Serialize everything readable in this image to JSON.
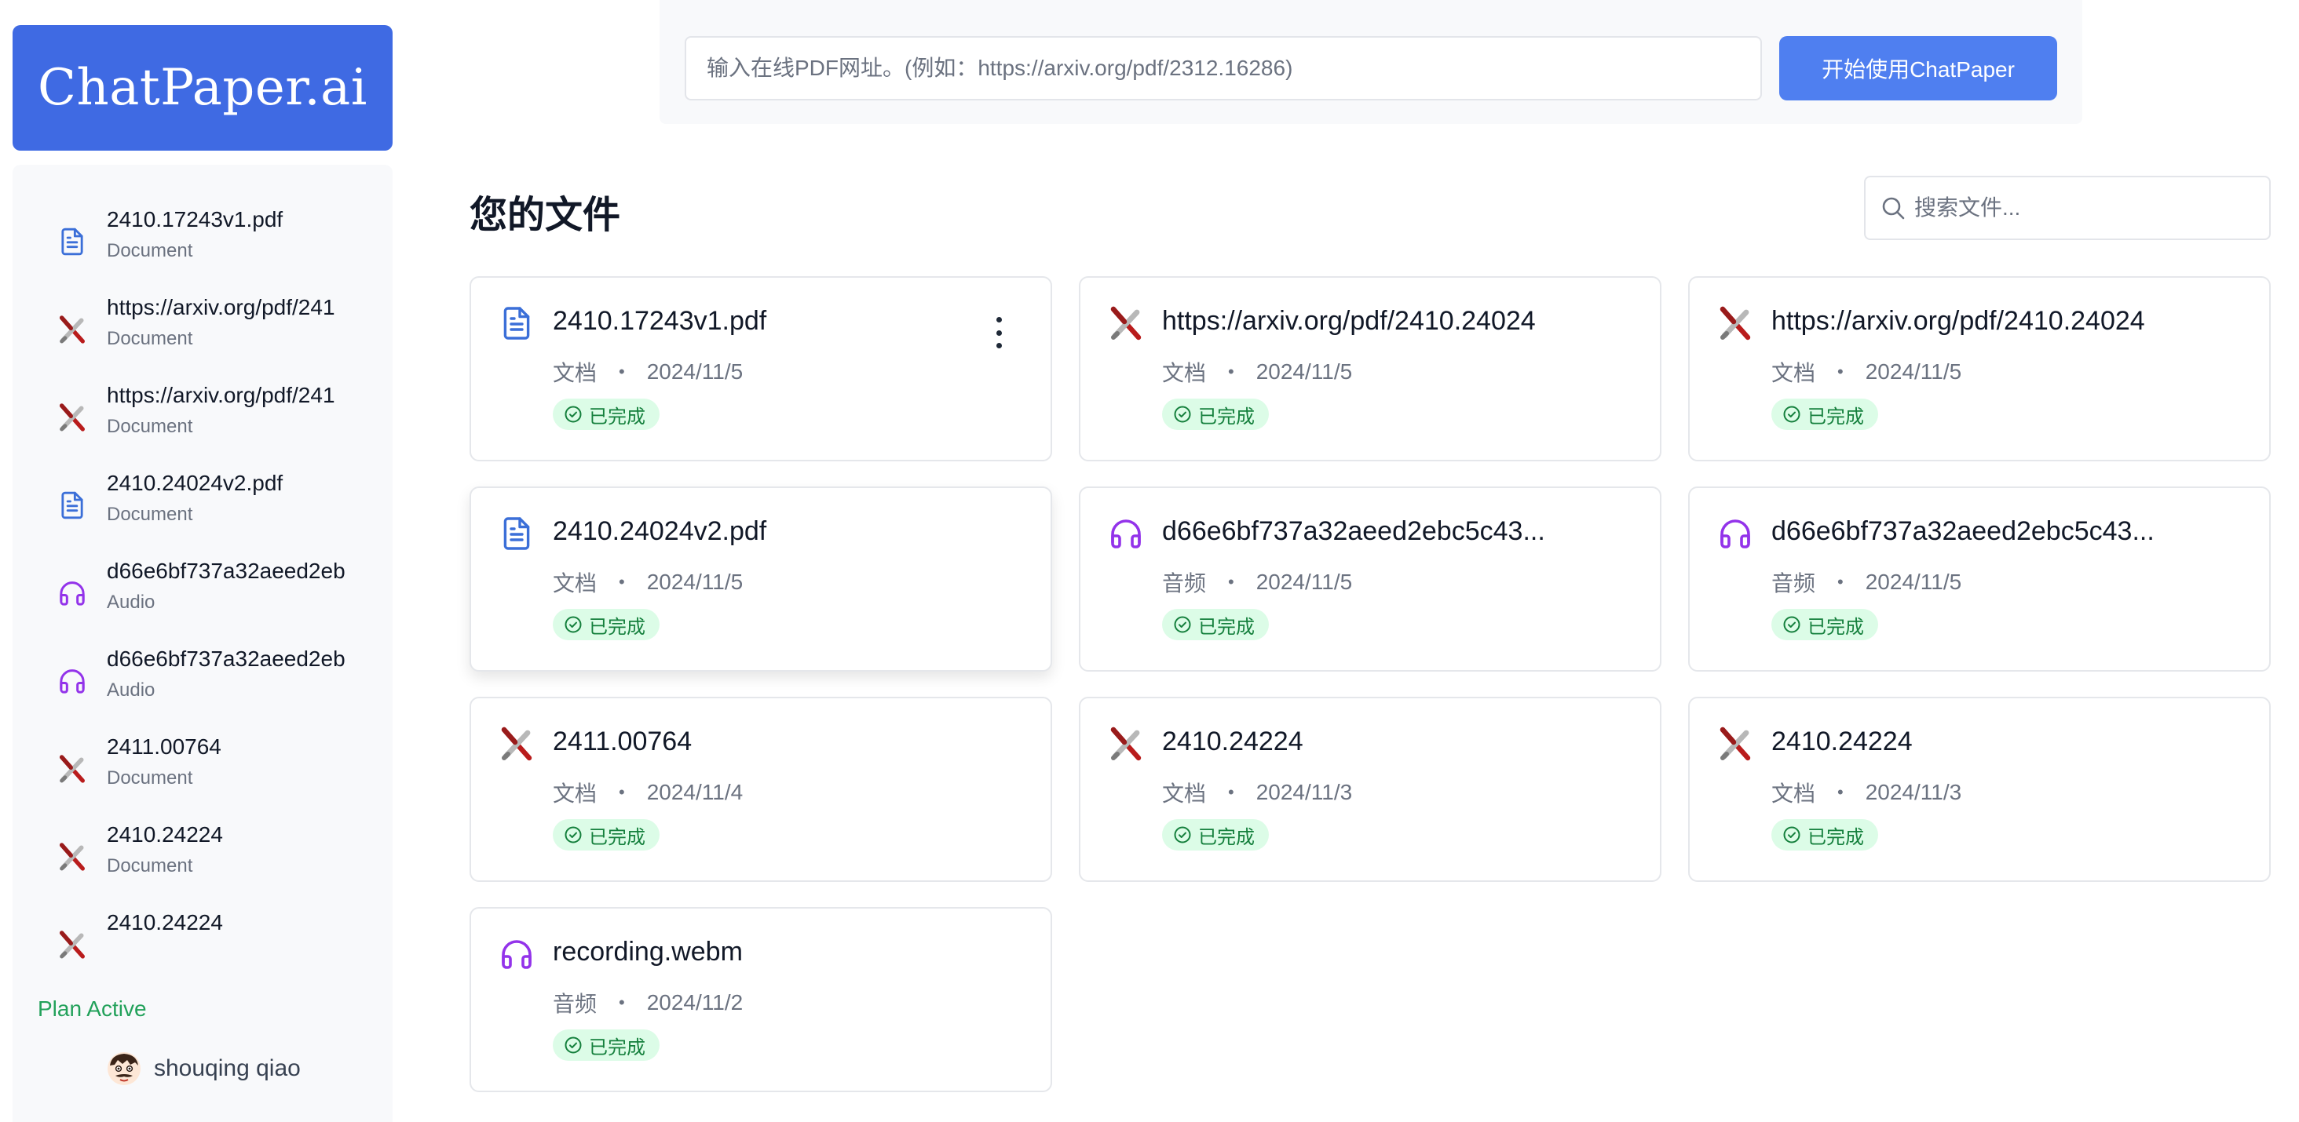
{
  "app": {
    "logo_text": "ChatPaper.ai"
  },
  "topbar": {
    "url_placeholder": "输入在线PDF网址。(例如：https://arxiv.org/pdf/2312.16286)",
    "start_button_label": "开始使用ChatPaper"
  },
  "main": {
    "title": "您的文件",
    "search_placeholder": "搜索文件..."
  },
  "sidebar": {
    "items": [
      {
        "title": "2410.17243v1.pdf",
        "subtitle": "Document",
        "icon": "document-icon"
      },
      {
        "title": "https://arxiv.org/pdf/241",
        "subtitle": "Document",
        "icon": "broken-pencil-icon"
      },
      {
        "title": "https://arxiv.org/pdf/241",
        "subtitle": "Document",
        "icon": "broken-pencil-icon"
      },
      {
        "title": "2410.24024v2.pdf",
        "subtitle": "Document",
        "icon": "document-icon"
      },
      {
        "title": "d66e6bf737a32aeed2eb",
        "subtitle": "Audio",
        "icon": "headphones-icon"
      },
      {
        "title": "d66e6bf737a32aeed2eb",
        "subtitle": "Audio",
        "icon": "headphones-icon"
      },
      {
        "title": "2411.00764",
        "subtitle": "Document",
        "icon": "broken-pencil-icon"
      },
      {
        "title": "2410.24224",
        "subtitle": "Document",
        "icon": "broken-pencil-icon"
      },
      {
        "title": "2410.24224",
        "subtitle": "",
        "icon": "broken-pencil-icon"
      }
    ],
    "plan_status": "Plan Active",
    "user_name": "shouqing qiao"
  },
  "files": [
    {
      "title": "2410.17243v1.pdf",
      "type": "文档",
      "date": "2024/11/5",
      "status": "已完成",
      "icon": "document-icon"
    },
    {
      "title": "https://arxiv.org/pdf/2410.24024",
      "type": "文档",
      "date": "2024/11/5",
      "status": "已完成",
      "icon": "broken-pencil-icon"
    },
    {
      "title": "https://arxiv.org/pdf/2410.24024",
      "type": "文档",
      "date": "2024/11/5",
      "status": "已完成",
      "icon": "broken-pencil-icon"
    },
    {
      "title": "2410.24024v2.pdf",
      "type": "文档",
      "date": "2024/11/5",
      "status": "已完成",
      "icon": "document-icon"
    },
    {
      "title": "d66e6bf737a32aeed2ebc5c43...",
      "type": "音频",
      "date": "2024/11/5",
      "status": "已完成",
      "icon": "headphones-icon"
    },
    {
      "title": "d66e6bf737a32aeed2ebc5c43...",
      "type": "音频",
      "date": "2024/11/5",
      "status": "已完成",
      "icon": "headphones-icon"
    },
    {
      "title": "2411.00764",
      "type": "文档",
      "date": "2024/11/4",
      "status": "已完成",
      "icon": "broken-pencil-icon"
    },
    {
      "title": "2410.24224",
      "type": "文档",
      "date": "2024/11/3",
      "status": "已完成",
      "icon": "broken-pencil-icon"
    },
    {
      "title": "2410.24224",
      "type": "文档",
      "date": "2024/11/3",
      "status": "已完成",
      "icon": "broken-pencil-icon"
    },
    {
      "title": "recording.webm",
      "type": "音频",
      "date": "2024/11/2",
      "status": "已完成",
      "icon": "headphones-icon"
    }
  ],
  "colors": {
    "brand": "#3f6ae3",
    "button": "#4f7ff0",
    "success": "#22a15a",
    "badge_bg": "#dcfce7",
    "audio_icon": "#9333ea",
    "doc_icon": "#3b6fd8"
  }
}
